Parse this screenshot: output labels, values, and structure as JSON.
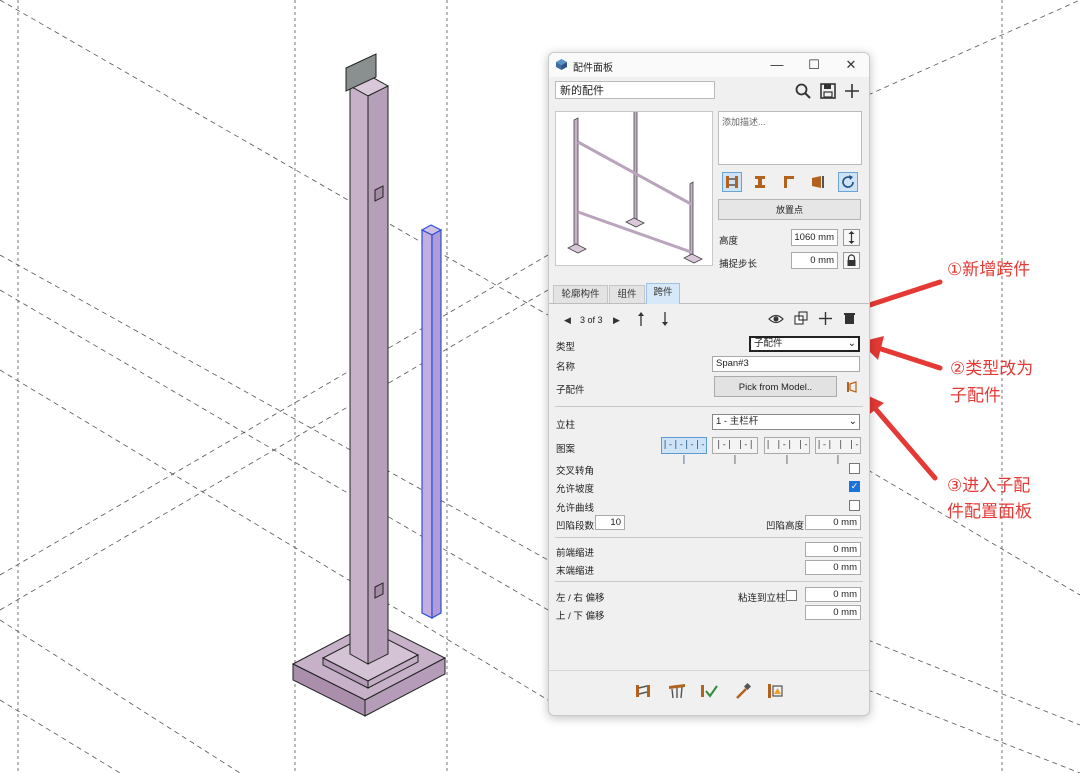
{
  "window": {
    "title": "配件面板",
    "minimize": "—",
    "maximize": "☐",
    "close": "✕"
  },
  "assembly_name": "新的配件",
  "description_placeholder": "添加描述...",
  "place_point_label": "放置点",
  "height": {
    "label": "高度",
    "value": "1060 mm"
  },
  "snap_step": {
    "label": "捕捉步长",
    "value": "0 mm"
  },
  "tabs": [
    {
      "label": "轮廓构件"
    },
    {
      "label": "组件"
    },
    {
      "label": "跨件"
    }
  ],
  "span_nav": {
    "prev": "◀",
    "counter": "3 of 3",
    "next": "▶"
  },
  "fields": {
    "type_label": "类型",
    "type_value": "子配件",
    "name_label": "名称",
    "name_value": "Span#3",
    "subassembly_label": "子配件",
    "pick_label": "Pick from Model..",
    "post_label": "立柱",
    "post_value": "1 - 主栏杆",
    "pattern_label": "图案",
    "patterns": [
      "|-|-|-|-|",
      "|-| |-| |",
      "| |-| |-|",
      "|-| | |-|"
    ],
    "cross_corner_label": "交叉转角",
    "allow_slope_label": "允许坡度",
    "allow_curve_label": "允许曲线",
    "sag_segments_label": "凹陷段数",
    "sag_segments_value": "10",
    "sag_height_label": "凹陷高度",
    "sag_height_value": "0 mm",
    "front_inset_label": "前端缩进",
    "front_inset_value": "0 mm",
    "end_inset_label": "末端缩进",
    "end_inset_value": "0 mm",
    "lr_offset_label": "左 / 右 偏移",
    "snap_post_label": "粘连到立柱",
    "lr_offset_value": "0 mm",
    "ud_offset_label": "上 / 下 偏移",
    "ud_offset_value": "0 mm"
  },
  "checkboxes": {
    "cross_corner": false,
    "allow_slope": true,
    "allow_curve": false,
    "snap_post": false
  },
  "annotations": {
    "a1": "①新增跨件",
    "a2_line1": "②类型改为",
    "a2_line2": "子配件",
    "a3_line1": "③进入子配",
    "a3_line2": "件配置面板"
  },
  "colors": {
    "accent_red": "#e53935",
    "selected_blue": "#2b4fd8",
    "post_purple": "#c6b1c9"
  }
}
